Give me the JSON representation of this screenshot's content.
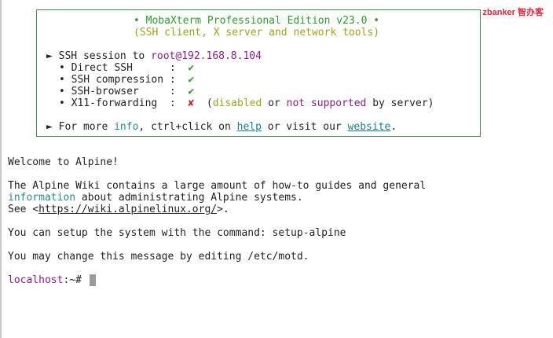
{
  "watermark": "zbanker 智办客",
  "banner": {
    "title": "• MobaXterm Professional Edition v23.0 •",
    "subtitle": "(SSH client, X server and network tools)",
    "session_bullet": "►",
    "session_prefix": "SSH session to",
    "session_target": "root@192.168.8.104",
    "features": [
      {
        "label": "• Direct SSH      :",
        "mark": "✔",
        "status": "ok"
      },
      {
        "label": "• SSH compression :",
        "mark": "✔",
        "status": "ok"
      },
      {
        "label": "• SSH-browser     :",
        "mark": "✔",
        "status": "ok"
      },
      {
        "label": "• X11-forwarding  :",
        "mark": "✘",
        "status": "fail"
      }
    ],
    "x11_note": {
      "open": "(",
      "disabled": "disabled",
      "or1": "or",
      "not_supported": "not supported",
      "by_server": "by server)"
    },
    "footer": {
      "bullet": "►",
      "prefix": "For more",
      "info": "info",
      "middle": ", ctrl+click on",
      "help": "help",
      "or_visit": "or visit our",
      "website": "website",
      "end": "."
    }
  },
  "motd": {
    "welcome": "Welcome to Alpine!",
    "wiki_line1": "The Alpine Wiki contains a large amount of how-to guides and general",
    "wiki_line2_highlight": "information",
    "wiki_line2_rest": " about administrating Alpine systems.",
    "see_prefix": "See <",
    "see_url": "https://wiki.alpinelinux.org/",
    "see_suffix": ">.",
    "setup_line": "You can setup the system with the command: setup-alpine",
    "change_line": "You may change this message by editing /etc/motd."
  },
  "prompt": {
    "host": "localhost",
    "rest": ":~#"
  },
  "colors": {
    "green": "#2e9b2e",
    "olive": "#a0a020",
    "purple": "#8a1b8a",
    "teal": "#2b8a8a",
    "red": "#c41e1e",
    "border": "#4c8a4c"
  }
}
